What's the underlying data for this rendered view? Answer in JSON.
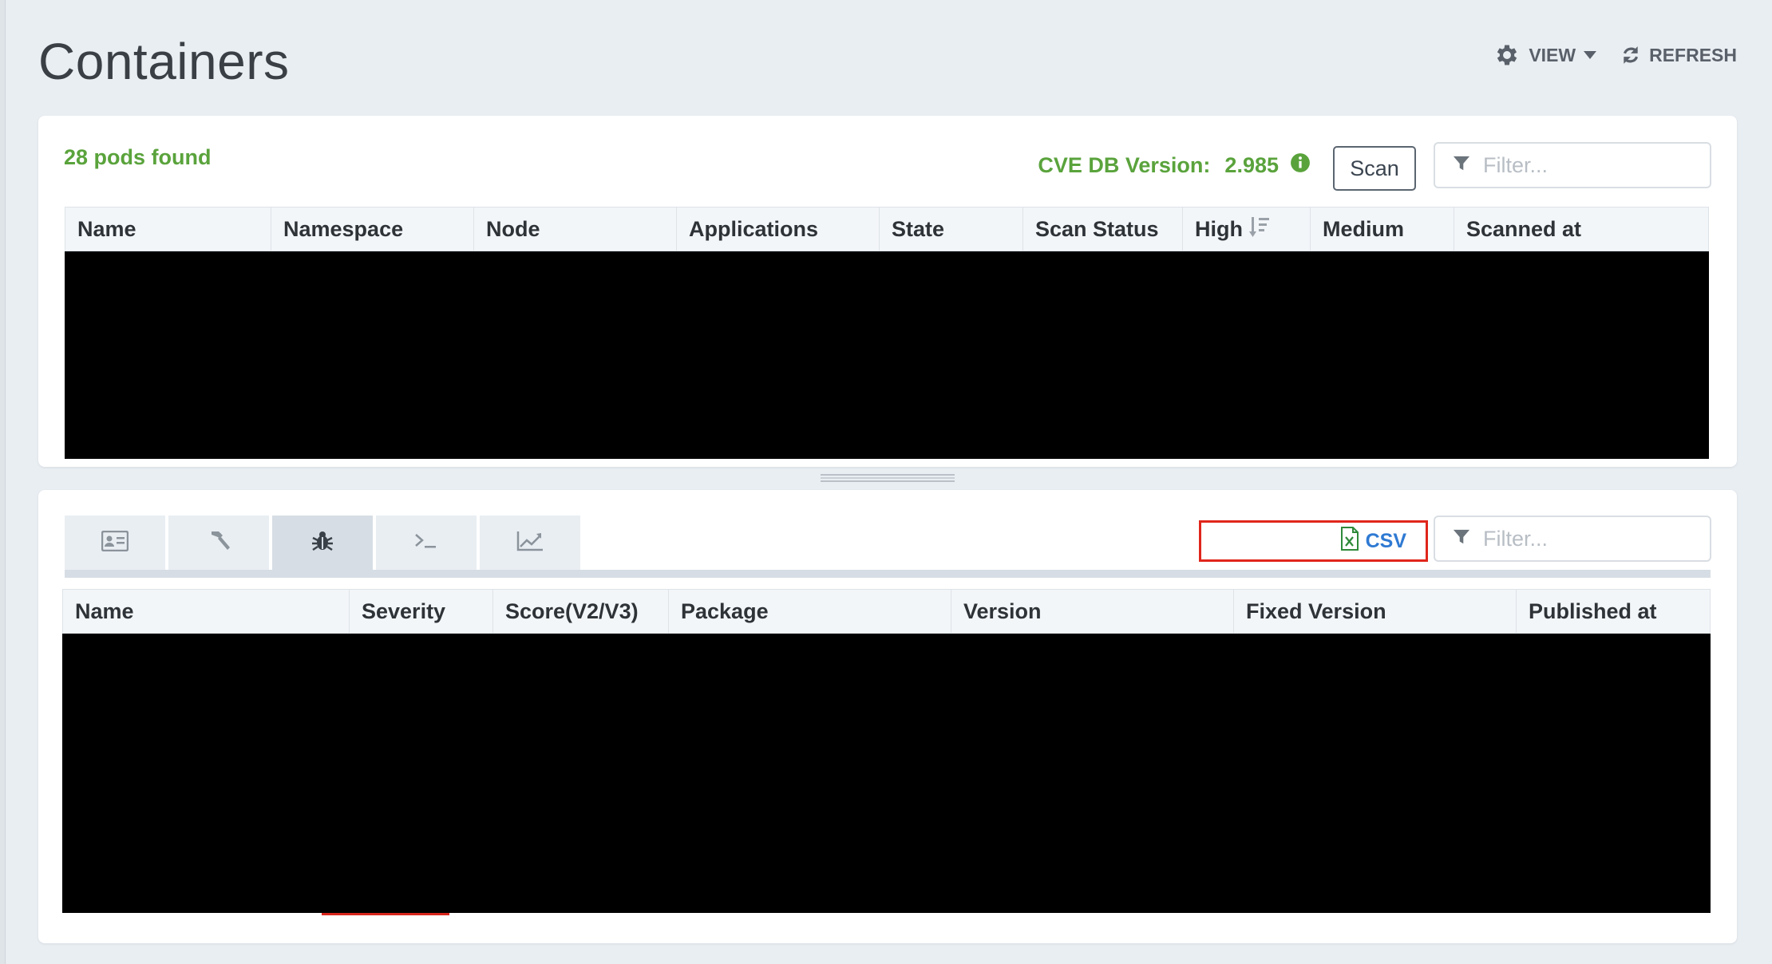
{
  "page": {
    "title": "Containers",
    "view_label": "VIEW",
    "refresh_label": "REFRESH",
    "icons": {
      "view": "gear-icon",
      "view_caret": "caret-down-icon",
      "refresh": "refresh-icon"
    }
  },
  "pods_panel": {
    "pods_found": "28 pods found",
    "cve_db_label": "CVE DB Version:",
    "cve_db_version": "2.985",
    "scan_label": "Scan",
    "filter_placeholder": "Filter...",
    "columns": [
      "Name",
      "Namespace",
      "Node",
      "Applications",
      "State",
      "Scan Status",
      "High",
      "Medium",
      "Scanned at"
    ],
    "sorted_column": "High",
    "sort_icon": "sort-descending-icon"
  },
  "details_panel": {
    "tabs": [
      {
        "name": "tab-details",
        "icon": "id-card-icon"
      },
      {
        "name": "tab-build",
        "icon": "hammer-icon"
      },
      {
        "name": "tab-vulnerabilities",
        "icon": "bug-icon",
        "active": true
      },
      {
        "name": "tab-console",
        "icon": "terminal-icon"
      },
      {
        "name": "tab-stats",
        "icon": "chart-line-icon"
      }
    ],
    "csv_label": "CSV",
    "csv_icon": "excel-file-icon",
    "filter_placeholder": "Filter...",
    "columns": [
      "Name",
      "Severity",
      "Score(V2/V3)",
      "Package",
      "Version",
      "Fixed Version",
      "Published at"
    ]
  },
  "colors": {
    "accent_green": "#5aa33c",
    "link_blue": "#2f7ad3",
    "highlight_red": "#e0261b",
    "background": "#e9eef3"
  }
}
